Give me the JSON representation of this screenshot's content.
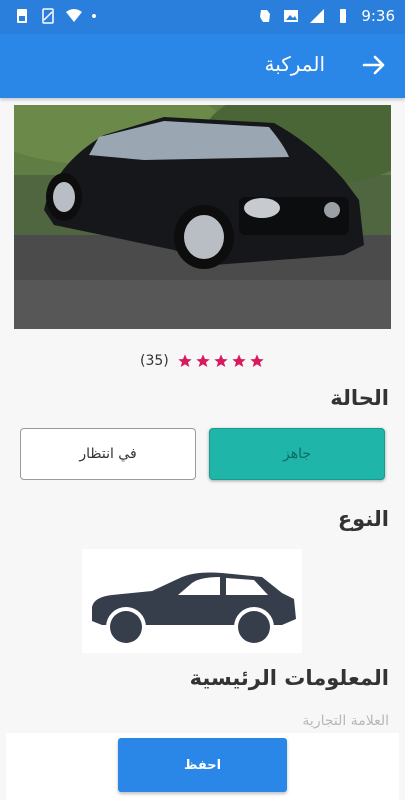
{
  "status_bar": {
    "time": "9:36"
  },
  "app_bar": {
    "title": "المركبة"
  },
  "rating": {
    "count": "(35)",
    "stars": 5
  },
  "sections": {
    "status_title": "الحالة",
    "type_title": "النوع",
    "main_info_title": "المعلومات الرئيسية"
  },
  "status_options": {
    "ready": "جاهز",
    "pending": "في انتظار"
  },
  "fields": {
    "brand_label": "العلامة التجارية"
  },
  "actions": {
    "save_label": "احفظ"
  },
  "colors": {
    "primary": "#2a87e8",
    "accent": "#1fb5a8",
    "star": "#d81b60"
  }
}
